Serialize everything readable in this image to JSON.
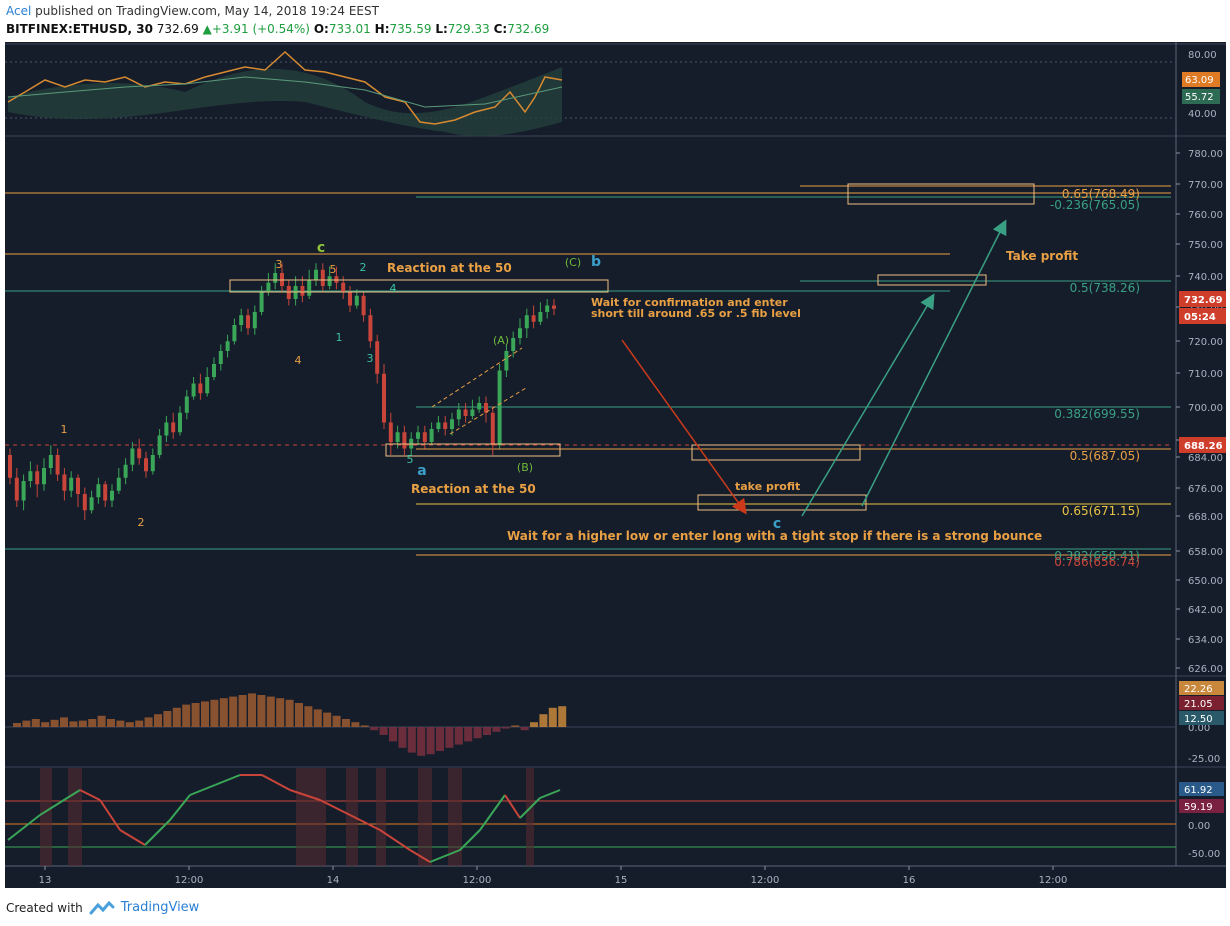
{
  "header": {
    "author": "Acel",
    "published": "published on TradingView.com, May 14, 2018 19:24 EEST",
    "symbol": "BITFINEX:ETHUSD, 30",
    "last": "732.69",
    "change": "+3.91 (+0.54%)",
    "o_label": "O:",
    "o_value": "733.01",
    "h_label": "H:",
    "h_value": "735.59",
    "l_label": "L:",
    "l_value": "729.33",
    "c_label": "C:",
    "c_value": "732.69"
  },
  "footer": {
    "created": "Created with",
    "brand": "TradingView",
    "logo_icon": "tradingview-logo-icon"
  },
  "colors": {
    "background": "#151d2b",
    "up": "#3aa657",
    "down": "#c9453a",
    "orange": "#e9a044",
    "teal": "#3aa084",
    "price_badge": "#cf3d2b"
  },
  "chart_data": {
    "type": "candlestick",
    "price_axis": {
      "ticks": [
        "780.00",
        "770.00",
        "760.00",
        "750.00",
        "740.00",
        "730.00",
        "720.00",
        "710.00",
        "700.00",
        "690.00",
        "684.00",
        "676.00",
        "668.00",
        "658.00",
        "650.00",
        "642.00",
        "634.00",
        "626.00"
      ],
      "tick_prices": [
        780,
        770,
        760,
        750,
        740,
        730,
        720,
        710,
        700,
        690,
        684,
        676,
        668,
        658,
        650,
        642,
        634,
        626
      ],
      "badges": [
        {
          "text": "732.69",
          "price": 732.69,
          "color": "#cf3d2b"
        },
        {
          "text": "05:24",
          "price": 729.2,
          "color": "#cf3d2b"
        },
        {
          "text": "688.26",
          "price": 688.26,
          "color": "#cf3d2b"
        }
      ]
    },
    "time_axis": {
      "labels": [
        "13",
        "12:00",
        "14",
        "12:00",
        "15",
        "12:00",
        "16",
        "12:00"
      ],
      "label_x": [
        45,
        189,
        333,
        477,
        621,
        765,
        909,
        1053
      ]
    },
    "fib_levels": [
      {
        "label": "0.65(768.49)",
        "price": 768.49,
        "color": "#e9a044"
      },
      {
        "label": "-0.236(765.05)",
        "price": 765.05,
        "color": "#3aa084"
      },
      {
        "label": "0.5(738.26)",
        "price": 738.26,
        "color": "#3aa084"
      },
      {
        "label": "0.382(699.55)",
        "price": 699.55,
        "color": "#3aa084"
      },
      {
        "label": "0.5(687.05)",
        "price": 687.05,
        "color": "#e9a044"
      },
      {
        "label": "0.65(671.15)",
        "price": 671.15,
        "color": "#e9c344"
      },
      {
        "label": "0.382(658.41)",
        "price": 658.41,
        "color": "#3aa084"
      },
      {
        "label": "0.786(656.74)",
        "price": 656.74,
        "color": "#c9453a"
      }
    ],
    "wave_labels": [
      {
        "text": "1",
        "color": "#e9a044"
      },
      {
        "text": "2",
        "color": "#e9a044"
      },
      {
        "text": "3",
        "color": "#e9a044"
      },
      {
        "text": "4",
        "color": "#e9a044"
      },
      {
        "text": "5",
        "color": "#e9a044"
      },
      {
        "text": "c",
        "color": "#8fc43a"
      },
      {
        "text": "1",
        "color": "#3ac3a0"
      },
      {
        "text": "2",
        "color": "#3ac3a0"
      },
      {
        "text": "3",
        "color": "#3ac3a0"
      },
      {
        "text": "4",
        "color": "#3ac3a0"
      },
      {
        "text": "5",
        "color": "#3ac3a0"
      },
      {
        "text": "a",
        "color": "#3a9fc9"
      },
      {
        "text": "(A)",
        "color": "#6fba3a"
      },
      {
        "text": "(B)",
        "color": "#6fba3a"
      },
      {
        "text": "(C)",
        "color": "#6fba3a"
      },
      {
        "text": "b",
        "color": "#3a9fc9"
      },
      {
        "text": "c",
        "color": "#3a9fc9"
      }
    ],
    "annotations": [
      "Reaction at the 50",
      "Reaction at the 50",
      "Wait for confirmation and enter",
      "short till around .65  or .5 fib level",
      "take profit",
      "Take profit",
      "Wait for a higher low or enter  long with a tight stop if there is a strong bounce"
    ],
    "rsi_panel": {
      "ticks": [
        "80.00",
        "40.00"
      ],
      "badges": [
        "63.09",
        "55.72"
      ]
    },
    "macd_panel": {
      "ticks": [
        "0.00",
        "-25.00"
      ],
      "badges": [
        "22.26",
        "21.05",
        "12.50"
      ]
    },
    "osc_panel": {
      "ticks": [
        "0.00",
        "-50.00"
      ],
      "badges": [
        "61.92",
        "59.19"
      ]
    }
  }
}
